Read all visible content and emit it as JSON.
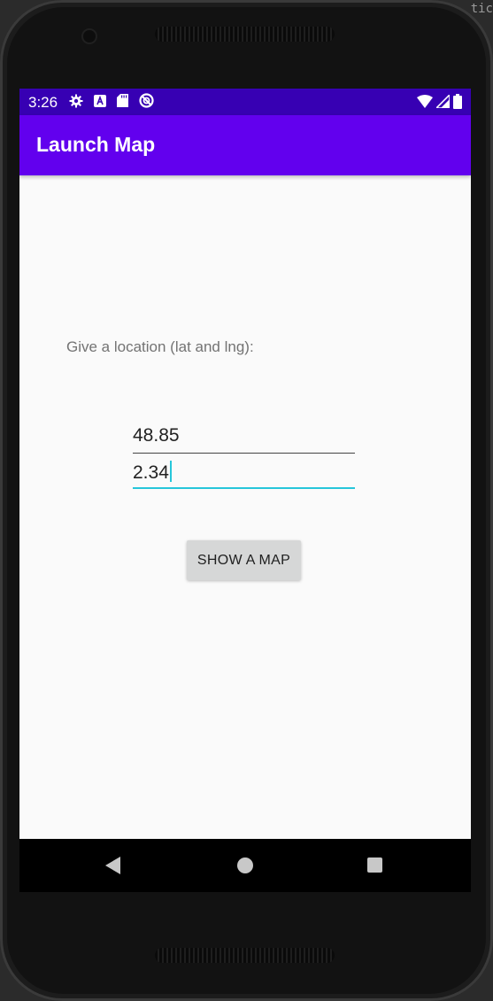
{
  "status_bar": {
    "time": "3:26",
    "left_icons": [
      "settings-icon",
      "a-badge-icon",
      "sd-card-icon",
      "no-disturb-icon"
    ],
    "right_icons": [
      "wifi-icon",
      "cell-signal-icon",
      "battery-icon"
    ],
    "color": "#3700b3"
  },
  "app_bar": {
    "title": "Launch Map",
    "color": "#6200ee"
  },
  "main": {
    "prompt": "Give a location (lat and lng):",
    "latitude_value": "48.85",
    "longitude_value": "2.34",
    "show_map_label": "SHOW A MAP"
  },
  "colors": {
    "accent": "#26c6da",
    "button_bg": "#d6d7d7"
  },
  "nav_bar": {
    "buttons": [
      "back-icon",
      "home-icon",
      "recents-icon"
    ]
  },
  "background_text": "tic"
}
